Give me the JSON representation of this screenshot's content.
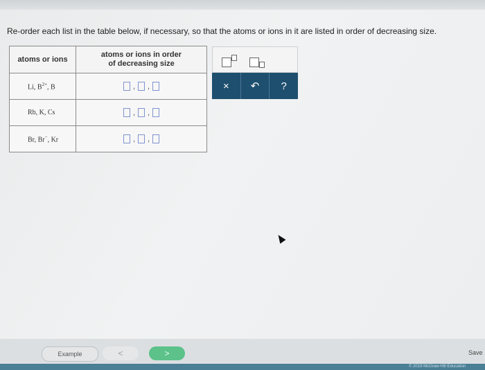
{
  "question": "Re-order each list in the table below, if necessary, so that the atoms or ions in it are listed in order of decreasing size.",
  "table": {
    "col1_header": "atoms or ions",
    "col2_header_line1": "atoms or ions in order",
    "col2_header_line2": "of decreasing size",
    "rows": [
      {
        "list": "Li, B2+, B"
      },
      {
        "list": "Rb, K, Cs"
      },
      {
        "list": "Br, Br−, Kr"
      }
    ]
  },
  "tools": {
    "clear_symbol": "×",
    "undo_symbol": "↶",
    "help_symbol": "?"
  },
  "footer": {
    "example_label": "Example",
    "prev_symbol": "<",
    "next_symbol": ">",
    "save_label": "Save",
    "copyright": "© 2019 McGraw-Hill Education"
  },
  "colors": {
    "tool_bar": "#1f4f6e",
    "next_button": "#5cc28a",
    "answer_slot": "#7f93cf"
  }
}
